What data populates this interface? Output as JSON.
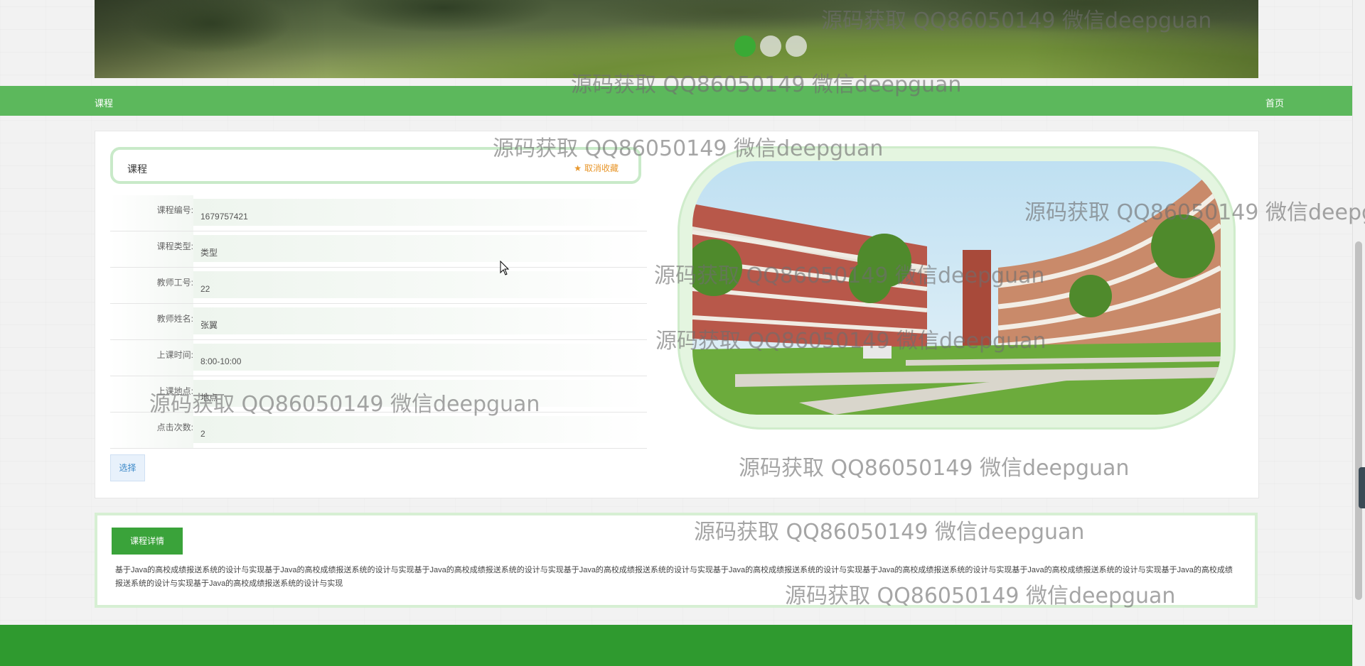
{
  "banner": {
    "slides": 3,
    "active_slide": 1
  },
  "nav": {
    "title": "课程",
    "home": "首页"
  },
  "course": {
    "title": "课程",
    "favorite_label": "取消收藏",
    "fields": [
      {
        "label": "课程编号:",
        "value": "1679757421"
      },
      {
        "label": "课程类型:",
        "value": "类型"
      },
      {
        "label": "教师工号:",
        "value": "22"
      },
      {
        "label": "教师姓名:",
        "value": "张翼"
      },
      {
        "label": "上课时间:",
        "value": "8:00-10:00"
      },
      {
        "label": "上课地点:",
        "value": "地点"
      },
      {
        "label": "点击次数:",
        "value": "2"
      }
    ],
    "select_label": "选择"
  },
  "detail": {
    "tab_label": "课程详情",
    "text": "基于Java的高校成绩报送系统的设计与实现基于Java的高校成绩报送系统的设计与实现基于Java的高校成绩报送系统的设计与实现基于Java的高校成绩报送系统的设计与实现基于Java的高校成绩报送系统的设计与实现基于Java的高校成绩报送系统的设计与实现基于Java的高校成绩报送系统的设计与实现基于Java的高校成绩报送系统的设计与实现基于Java的高校成绩报送系统的设计与实现"
  },
  "watermark": "源码获取 QQ86050149 微信deepguan",
  "colors": {
    "nav": "#5cb85c",
    "footer": "#2f9a2f",
    "favorite": "#e8962a",
    "active_dot": "#3aaa35"
  }
}
